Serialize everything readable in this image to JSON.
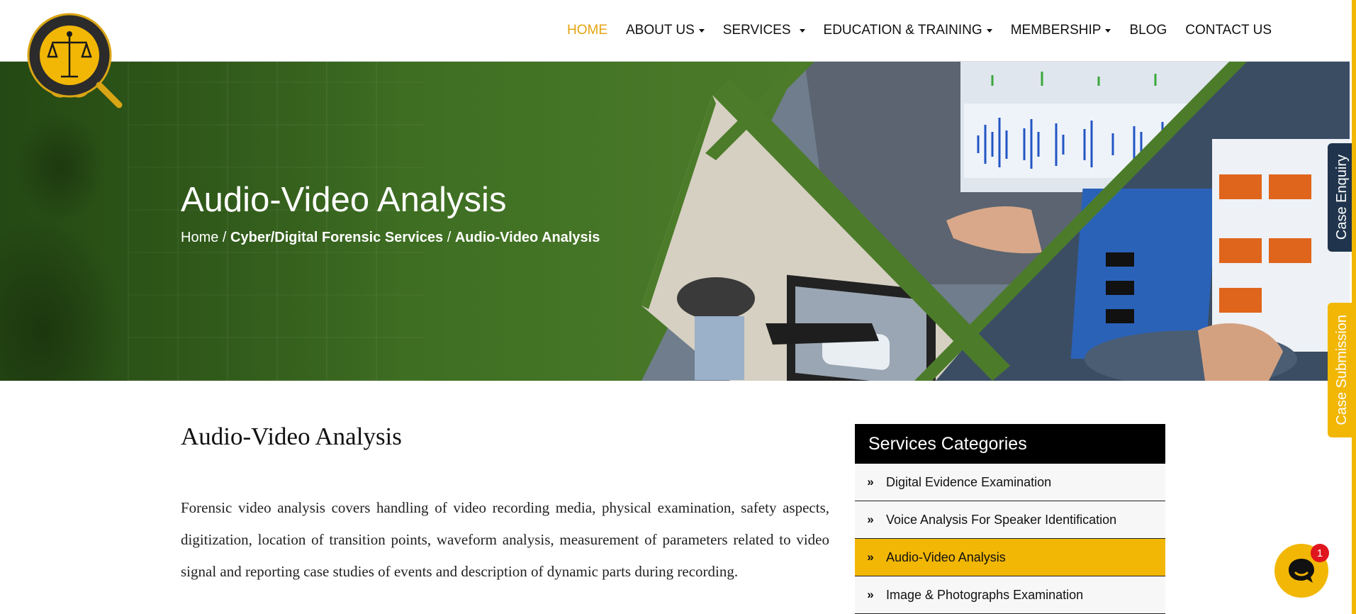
{
  "nav": {
    "home": "HOME",
    "about": "ABOUT US",
    "services": "SERVICES",
    "education": "EDUCATION & TRAINING",
    "membership": "MEMBERSHIP",
    "blog": "BLOG",
    "contact": "CONTACT US"
  },
  "banner": {
    "title": "Audio-Video Analysis",
    "breadcrumb": {
      "home": "Home",
      "sep": " / ",
      "parent": "Cyber/Digital Forensic Services",
      "current": "Audio-Video Analysis"
    }
  },
  "content": {
    "title": "Audio-Video Analysis",
    "paragraph": "Forensic video analysis covers handling of video recording media, physical examination, safety aspects, digitization, location of transition points, waveform analysis, measurement of parameters related to video signal and reporting case studies of events and description of dynamic parts during recording."
  },
  "sidebar": {
    "title": "Services Categories",
    "items": [
      {
        "label": "Digital Evidence Examination"
      },
      {
        "label": "Voice Analysis For Speaker Identification"
      },
      {
        "label": "Audio-Video Analysis"
      },
      {
        "label": "Image & Photographs Examination"
      }
    ]
  },
  "side_tabs": {
    "enquiry": "Case Enquiry",
    "submission": "Case Submission"
  },
  "chat": {
    "badge": "1"
  },
  "colors": {
    "accent": "#f2b705",
    "nav_active": "#e3a412",
    "banner_green": "#4c7c2a",
    "enquiry_tab": "#20354d"
  }
}
